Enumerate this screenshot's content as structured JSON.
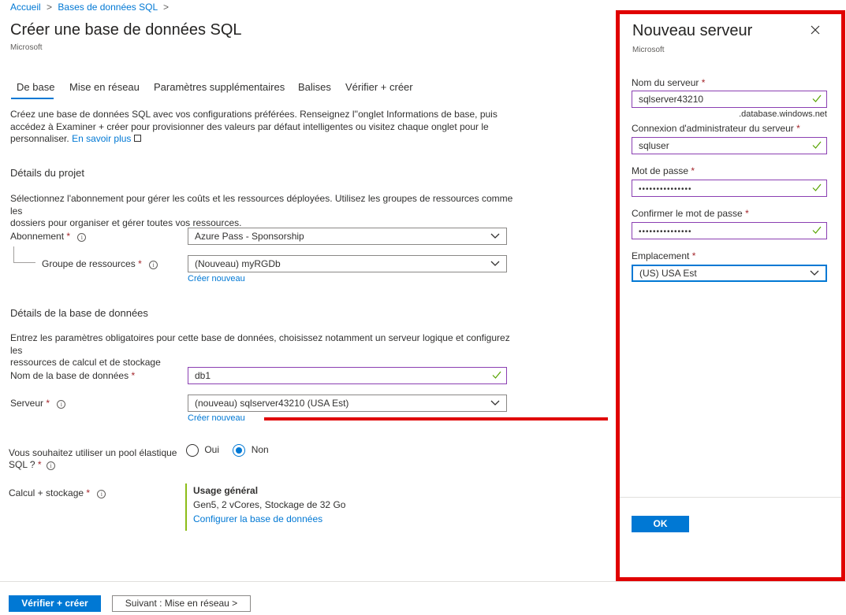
{
  "breadcrumb": {
    "items": [
      "Accueil",
      "Bases de données SQL"
    ]
  },
  "page": {
    "title": "Créer une base de données SQL",
    "subtitle": "Microsoft"
  },
  "tabs": [
    "De base",
    "Mise en réseau",
    "Paramètres supplémentaires",
    "Balises",
    "Vérifier + créer"
  ],
  "intro": {
    "line1": "Créez une base de données SQL avec vos configurations préférées. Renseignez l''onglet Informations de base, puis",
    "line2": "accédez à Examiner + créer pour provisionner des valeurs par défaut intelligentes ou visitez chaque onglet pour le",
    "line3": "personnaliser.",
    "link": "En savoir plus"
  },
  "project": {
    "title": "Détails du projet",
    "desc1": "Sélectionnez l'abonnement pour gérer les coûts et les ressources déployées. Utilisez les groupes de ressources comme les",
    "desc2": "dossiers pour organiser et gérer toutes vos ressources.",
    "subscription_label": "Abonnement",
    "subscription_value": "Azure Pass - Sponsorship",
    "rg_label": "Groupe de ressources",
    "rg_value": "(Nouveau) myRGDb",
    "rg_create": "Créer nouveau"
  },
  "database": {
    "title": "Détails de la base de données",
    "desc1": "Entrez les paramètres obligatoires pour cette base de données, choisissez notamment un serveur logique et configurez les",
    "desc2": "ressources de calcul et de stockage",
    "name_label": "Nom de la base de données",
    "name_value": "db1",
    "server_label": "Serveur",
    "server_value": "(nouveau) sqlserver43210 (USA Est)",
    "server_create": "Créer nouveau",
    "pool_label1": "Vous souhaitez utiliser un pool élastique",
    "pool_label2": "SQL ?",
    "pool_yes": "Oui",
    "pool_no": "Non",
    "compute_label": "Calcul + stockage",
    "compute_title": "Usage général",
    "compute_desc": "Gen5, 2 vCores, Stockage de 32 Go",
    "compute_link": "Configurer la base de données"
  },
  "footer": {
    "review": "Vérifier + créer",
    "next": "Suivant : Mise en réseau >"
  },
  "panel": {
    "title": "Nouveau serveur",
    "subtitle": "Microsoft",
    "server_name_label": "Nom du serveur",
    "server_name_value": "sqlserver43210",
    "suffix": ".database.windows.net",
    "admin_label": "Connexion d'administrateur du serveur",
    "admin_value": "sqluser",
    "password_label": "Mot de passe",
    "password_value": "•••••••••••••••",
    "confirm_label": "Confirmer le mot de passe",
    "confirm_value": "•••••••••••••••",
    "location_label": "Emplacement",
    "location_value": "(US) USA Est",
    "ok": "OK"
  },
  "colors": {
    "accent": "#0078d4",
    "highlight": "#e00000",
    "valid_border": "#8b3fb2",
    "check": "#57a300"
  },
  "required_mark": "*"
}
